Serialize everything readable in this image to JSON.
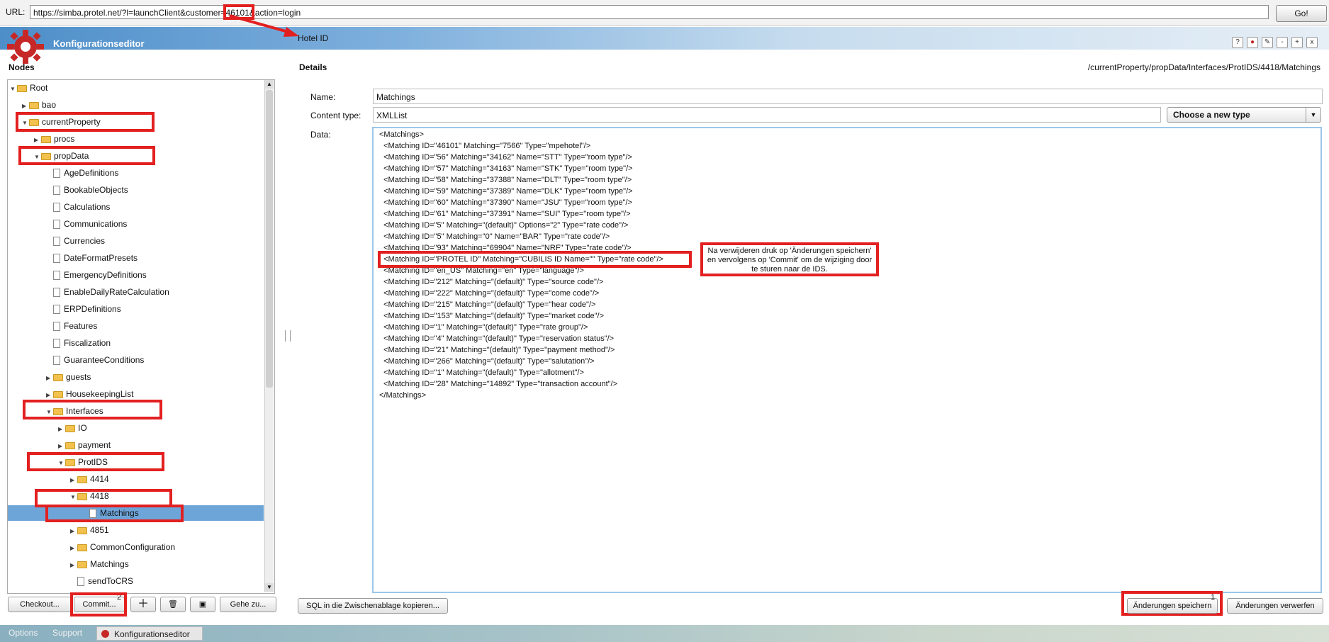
{
  "url_bar": {
    "label": "URL:",
    "url": "https://simba.protel.net/?l=launchClient&customer=46101&action=login",
    "go_label": "Go!"
  },
  "titlebar": {
    "title": "Konfigurationseditor",
    "annotation": "Hotel ID",
    "buttons": [
      "?",
      "●",
      "✎",
      "-",
      "+",
      "x"
    ]
  },
  "nodes": {
    "title": "Nodes",
    "tree": [
      {
        "label": "Root",
        "type": "folder",
        "open": true,
        "level": 0
      },
      {
        "label": "bao",
        "type": "folder",
        "open": false,
        "level": 1
      },
      {
        "label": "currentProperty",
        "type": "folder",
        "open": true,
        "level": 1
      },
      {
        "label": "procs",
        "type": "folder",
        "open": false,
        "level": 2
      },
      {
        "label": "propData",
        "type": "folder",
        "open": true,
        "level": 2
      },
      {
        "label": "AgeDefinitions",
        "type": "file",
        "level": 3
      },
      {
        "label": "BookableObjects",
        "type": "file",
        "level": 3
      },
      {
        "label": "Calculations",
        "type": "file",
        "level": 3
      },
      {
        "label": "Communications",
        "type": "file",
        "level": 3
      },
      {
        "label": "Currencies",
        "type": "file",
        "level": 3
      },
      {
        "label": "DateFormatPresets",
        "type": "file",
        "level": 3
      },
      {
        "label": "EmergencyDefinitions",
        "type": "file",
        "level": 3
      },
      {
        "label": "EnableDailyRateCalculation",
        "type": "file",
        "level": 3
      },
      {
        "label": "ERPDefinitions",
        "type": "file",
        "level": 3
      },
      {
        "label": "Features",
        "type": "file",
        "level": 3
      },
      {
        "label": "Fiscalization",
        "type": "file",
        "level": 3
      },
      {
        "label": "GuaranteeConditions",
        "type": "file",
        "level": 3
      },
      {
        "label": "guests",
        "type": "folder",
        "open": false,
        "level": 3
      },
      {
        "label": "HousekeepingList",
        "type": "folder",
        "open": false,
        "level": 3
      },
      {
        "label": "Interfaces",
        "type": "folder",
        "open": true,
        "level": 3
      },
      {
        "label": "IO",
        "type": "folder",
        "open": false,
        "level": 4
      },
      {
        "label": "payment",
        "type": "folder",
        "open": false,
        "level": 4
      },
      {
        "label": "ProtIDS",
        "type": "folder",
        "open": true,
        "level": 4
      },
      {
        "label": "4414",
        "type": "folder",
        "open": false,
        "level": 5
      },
      {
        "label": "4418",
        "type": "folder",
        "open": true,
        "level": 5
      },
      {
        "label": "Matchings",
        "type": "file",
        "level": 6,
        "selected": true
      },
      {
        "label": "4851",
        "type": "folder",
        "open": false,
        "level": 5
      },
      {
        "label": "CommonConfiguration",
        "type": "folder",
        "open": false,
        "level": 5
      },
      {
        "label": "Matchings",
        "type": "folder",
        "open": false,
        "level": 5
      },
      {
        "label": "sendToCRS",
        "type": "file",
        "level": 5
      }
    ],
    "buttons": {
      "checkout": "Checkout...",
      "commit": "Commit...",
      "goto": "Gehe zu..."
    },
    "commit_step": "2"
  },
  "details": {
    "title": "Details",
    "path": "/currentProperty/propData/Interfaces/ProtIDS/4418/Matchings",
    "name_label": "Name:",
    "name_value": "Matchings",
    "ctype_label": "Content type:",
    "ctype_value": "XMLList",
    "type_select": "Choose a new type",
    "data_label": "Data:",
    "xml_lines": [
      "<Matchings>",
      "  <Matching ID=\"46101\" Matching=\"7566\" Type=\"mpehotel\"/>",
      "  <Matching ID=\"56\" Matching=\"34162\" Name=\"STT\" Type=\"room type\"/>",
      "  <Matching ID=\"57\" Matching=\"34163\" Name=\"STK\" Type=\"room type\"/>",
      "  <Matching ID=\"58\" Matching=\"37388\" Name=\"DLT\" Type=\"room type\"/>",
      "  <Matching ID=\"59\" Matching=\"37389\" Name=\"DLK\" Type=\"room type\"/>",
      "  <Matching ID=\"60\" Matching=\"37390\" Name=\"JSU\" Type=\"room type\"/>",
      "  <Matching ID=\"61\" Matching=\"37391\" Name=\"SUI\" Type=\"room type\"/>",
      "  <Matching ID=\"5\" Matching=\"(default)\" Options=\"2\" Type=\"rate code\"/>",
      "  <Matching ID=\"5\" Matching=\"0\" Name=\"BAR\" Type=\"rate code\"/>",
      "  <Matching ID=\"93\" Matching=\"69904\" Name=\"NRF\" Type=\"rate code\"/>",
      "  <Matching ID=\"PROTEL ID\" Matching=\"CUBILIS ID Name=\"\" Type=\"rate code\"/>",
      "  <Matching ID=\"en_US\" Matching=\"en\" Type=\"language\"/>",
      "  <Matching ID=\"212\" Matching=\"(default)\" Type=\"source code\"/>",
      "  <Matching ID=\"222\" Matching=\"(default)\" Type=\"come code\"/>",
      "  <Matching ID=\"215\" Matching=\"(default)\" Type=\"hear code\"/>",
      "  <Matching ID=\"153\" Matching=\"(default)\" Type=\"market code\"/>",
      "  <Matching ID=\"1\" Matching=\"(default)\" Type=\"rate group\"/>",
      "  <Matching ID=\"4\" Matching=\"(default)\" Type=\"reservation status\"/>",
      "  <Matching ID=\"21\" Matching=\"(default)\" Type=\"payment method\"/>",
      "  <Matching ID=\"266\" Matching=\"(default)\" Type=\"salutation\"/>",
      "  <Matching ID=\"1\" Matching=\"(default)\" Type=\"allotment\"/>",
      "  <Matching ID=\"28\" Matching=\"14892\" Type=\"transaction account\"/>",
      "</Matchings>"
    ],
    "note": "Na verwijderen druk op 'Änderungen speichern' en vervolgens op 'Commit' om de wijziging door te sturen naar de IDS.",
    "buttons": {
      "sql": "SQL in die Zwischenablage kopieren...",
      "save": "Änderungen speichern",
      "discard": "Änderungen verwerfen"
    },
    "save_step": "1"
  },
  "taskbar": {
    "options": "Options",
    "support": "Support",
    "active": "Konfigurationseditor"
  },
  "colors": {
    "annotation": "#e32020",
    "selection": "#6ea5d8",
    "titlebar": "#4d8ec9"
  }
}
